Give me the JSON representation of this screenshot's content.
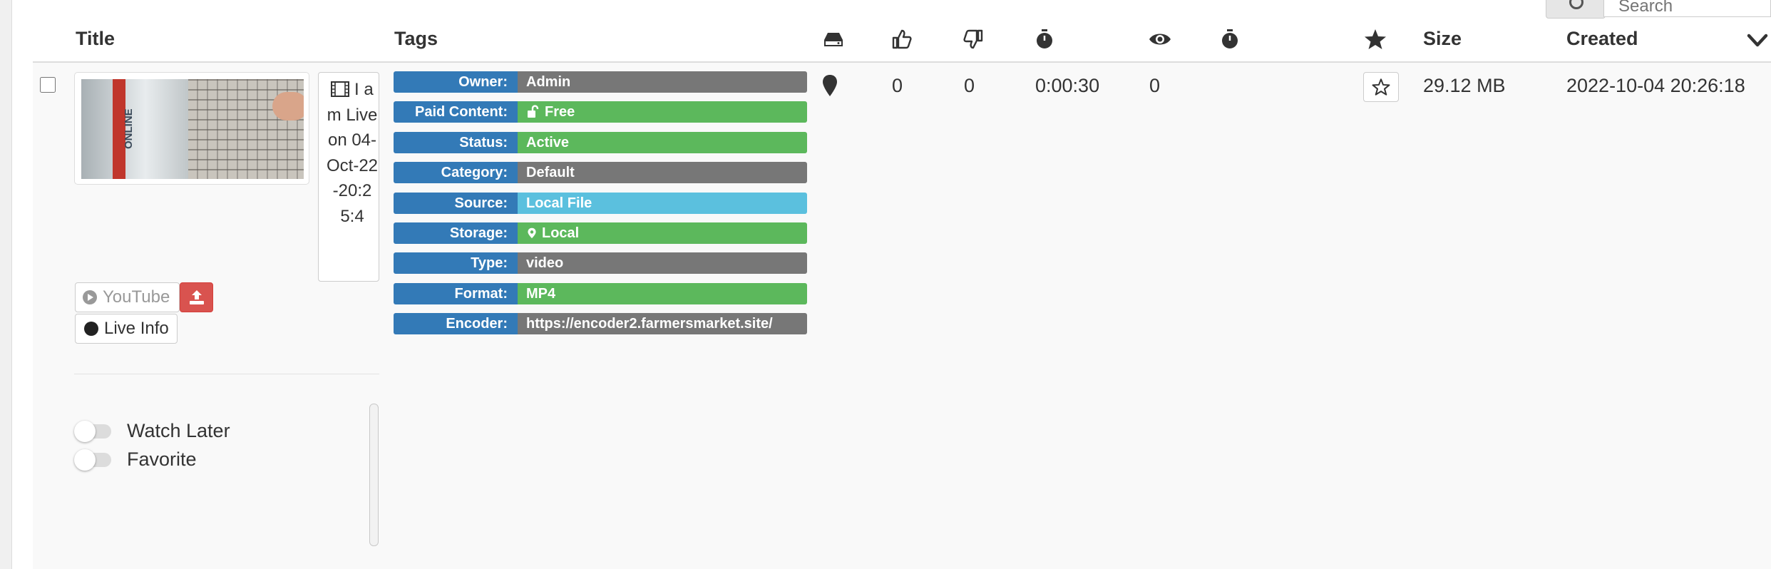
{
  "search": {
    "placeholder": "Search"
  },
  "table": {
    "headers": {
      "title": "Title",
      "tags": "Tags",
      "size": "Size",
      "created": "Created"
    },
    "header_icons": [
      "hdd-icon",
      "thumbs-up-icon",
      "thumbs-down-icon",
      "stopwatch-icon",
      "eye-icon",
      "stopwatch-icon",
      "star-icon",
      "sort-chevron-icon"
    ]
  },
  "row": {
    "title": "I am Live on 04-Oct-22-20:25:4",
    "buttons": {
      "youtube": "YouTube",
      "live_info": "Live Info"
    },
    "toggles": {
      "watch_later": "Watch Later",
      "favorite": "Favorite"
    },
    "tags": [
      {
        "key": "Owner:",
        "value": "Admin",
        "style": "default",
        "icon": ""
      },
      {
        "key": "Paid Content:",
        "value": "Free",
        "style": "success",
        "icon": "unlock-icon"
      },
      {
        "key": "Status:",
        "value": "Active",
        "style": "success",
        "icon": ""
      },
      {
        "key": "Category:",
        "value": "Default",
        "style": "default",
        "icon": ""
      },
      {
        "key": "Source:",
        "value": "Local File",
        "style": "info",
        "icon": ""
      },
      {
        "key": "Storage:",
        "value": "Local",
        "style": "success",
        "icon": "map-marker-icon"
      },
      {
        "key": "Type:",
        "value": "video",
        "style": "default",
        "icon": ""
      },
      {
        "key": "Format:",
        "value": "MP4",
        "style": "success",
        "icon": ""
      },
      {
        "key": "Encoder:",
        "value": "https://encoder2.farmersmarket.site/",
        "style": "default",
        "icon": ""
      }
    ],
    "likes": "0",
    "dislikes": "0",
    "duration": "0:00:30",
    "views": "0",
    "size": "29.12 MB",
    "created": "2022-10-04 20:26:18"
  },
  "thumbnail_text": "ONLINE",
  "colors": {
    "primary": "#337ab7",
    "success": "#5cb85c",
    "info": "#5bc0de",
    "default": "#777777",
    "danger": "#d9534f"
  }
}
